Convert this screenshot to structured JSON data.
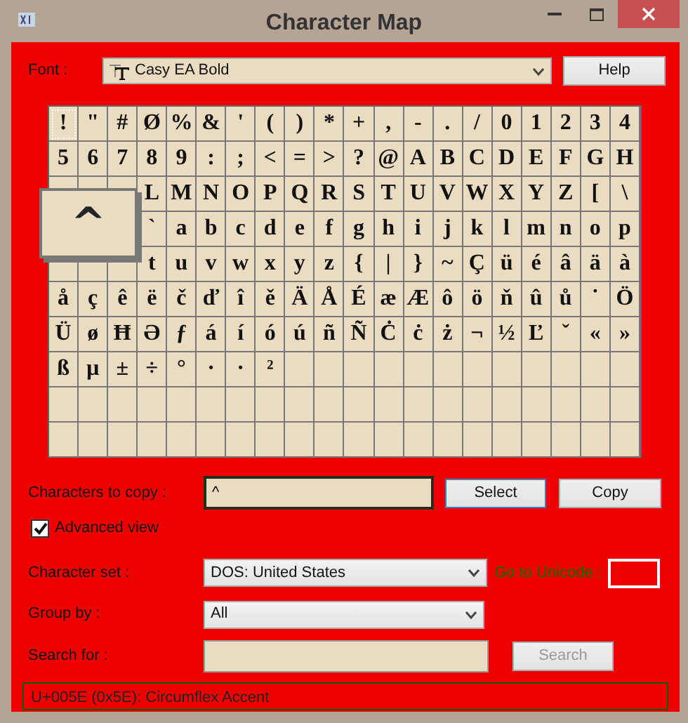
{
  "window": {
    "title": "Character Map"
  },
  "font": {
    "label": "Font :",
    "value": "Casy EA Bold"
  },
  "help_button": "Help",
  "grid": {
    "rows": [
      [
        "!",
        "\"",
        "#",
        "Ø",
        "%",
        "&",
        "'",
        "(",
        ")",
        "*",
        "+",
        ",",
        "-",
        ".",
        "/",
        "0",
        "1",
        "2",
        "3",
        "4"
      ],
      [
        "5",
        "6",
        "7",
        "8",
        "9",
        ":",
        ";",
        "<",
        "=",
        ">",
        "?",
        "@",
        "A",
        "B",
        "C",
        "D",
        "E",
        "F",
        "G",
        "H"
      ],
      [
        null,
        null,
        null,
        "L",
        "M",
        "N",
        "O",
        "P",
        "Q",
        "R",
        "S",
        "T",
        "U",
        "V",
        "W",
        "X",
        "Y",
        "Z",
        "[",
        "\\"
      ],
      [
        null,
        null,
        null,
        "`",
        "a",
        "b",
        "c",
        "d",
        "e",
        "f",
        "g",
        "h",
        "i",
        "j",
        "k",
        "l",
        "m",
        "n",
        "o",
        "p"
      ],
      [
        null,
        null,
        null,
        "t",
        "u",
        "v",
        "w",
        "x",
        "y",
        "z",
        "{",
        "|",
        "}",
        "~",
        "Ç",
        "ü",
        "é",
        "â",
        "ä",
        "à"
      ],
      [
        "å",
        "ç",
        "ê",
        "ë",
        "č",
        "ď",
        "î",
        "ě",
        "Ä",
        "Å",
        "É",
        "æ",
        "Æ",
        "ô",
        "ö",
        "ň",
        "û",
        "ů",
        "˙",
        "Ö"
      ],
      [
        "Ü",
        "ø",
        "Ħ",
        "Ə",
        "ƒ",
        "á",
        "í",
        "ó",
        "ú",
        "ñ",
        "Ñ",
        "Ċ",
        "ċ",
        "ż",
        "¬",
        "½",
        "Ľ",
        "ˇ",
        "«",
        "»"
      ],
      [
        "ß",
        "µ",
        "±",
        "÷",
        "°",
        "·",
        "·",
        "²"
      ]
    ]
  },
  "magnifier": {
    "char": "^"
  },
  "copy": {
    "label": "Characters to copy :",
    "value": "^"
  },
  "select_button": "Select",
  "copy_button": "Copy",
  "advanced_view": {
    "label": "Advanced view",
    "checked": true
  },
  "character_set": {
    "label": "Character set :",
    "value": "DOS: United States"
  },
  "goto_unicode": {
    "label": "Go to Unicode :"
  },
  "group_by": {
    "label": "Group by :",
    "value": "All"
  },
  "search": {
    "label": "Search for :"
  },
  "search_button": {
    "label": "Search",
    "disabled": true
  },
  "status_bar": "U+005E (0x5E): Circumflex Accent"
}
